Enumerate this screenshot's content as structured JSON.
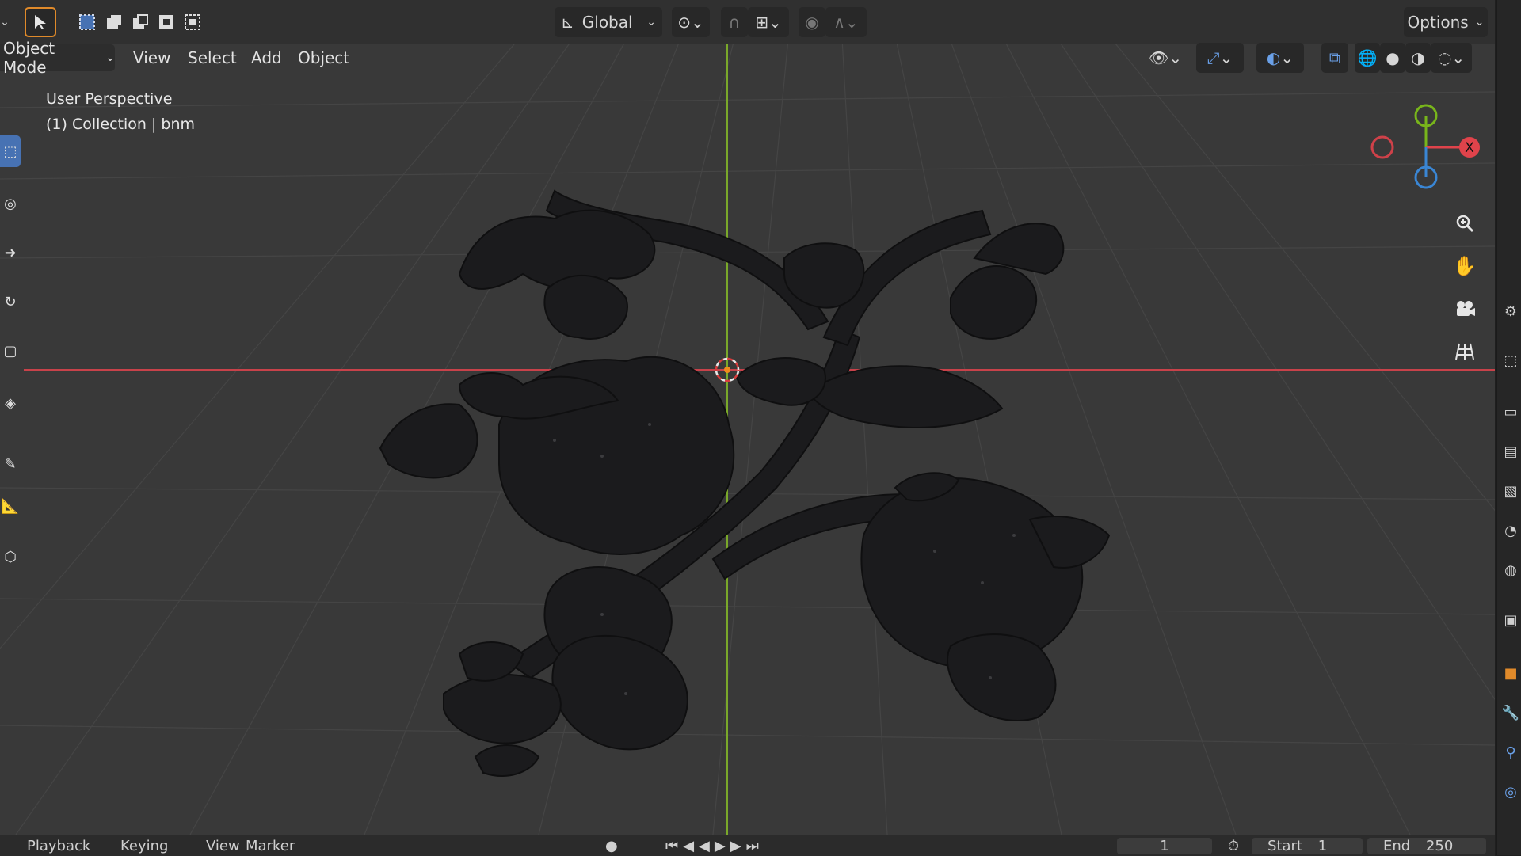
{
  "header": {
    "transform_orientation": "Global",
    "options_label": "Options",
    "icons": {
      "select_tool": "cursor-arrow-icon",
      "select_modes": [
        "select-new-icon",
        "select-extend-icon",
        "select-subtract-icon",
        "select-invert-icon",
        "select-intersect-icon"
      ],
      "orientation": "transform-orientation-icon",
      "pivot": "pivot-point-icon",
      "snap": "snap-magnet-icon",
      "snap_target": "snap-increment-icon",
      "proportional": "proportional-editing-icon",
      "falloff": "falloff-curve-icon"
    }
  },
  "view_header": {
    "mode": "Object Mode",
    "menus": [
      "View",
      "Select",
      "Add",
      "Object"
    ],
    "icons": [
      "visibility-eye-icon",
      "gizmo-icon",
      "overlay-icon",
      "xray-icon",
      "wireframe-shading-icon",
      "solid-shading-icon",
      "material-shading-icon",
      "rendered-shading-icon"
    ]
  },
  "viewport": {
    "perspective_label": "User Perspective",
    "collection_label": "(1) Collection | bnm",
    "axis_x_label": "X",
    "colors": {
      "x_axis": "#e0434b",
      "y_axis": "#78b51b",
      "z_axis": "#3a86d4",
      "background": "#393939",
      "model": "#1c1c1e"
    },
    "navigation": [
      "zoom-icon",
      "pan-hand-icon",
      "camera-icon",
      "grid-toggle-icon"
    ]
  },
  "left_toolbar": [
    "select-box-icon",
    "cursor-icon",
    "move-icon",
    "rotate-icon",
    "scale-icon",
    "transform-icon",
    "annotate-icon",
    "measure-icon",
    "add-cube-icon"
  ],
  "props_strip": [
    "tool-icon",
    "render-icon",
    "output-icon",
    "view-layer-icon",
    "scene-icon",
    "world-icon",
    "collection-icon",
    "object-icon",
    "modifier-icon",
    "particles-icon",
    "physics-icon",
    "constraints-icon"
  ],
  "timeline": {
    "items": [
      "Playback",
      "Keying",
      "View",
      "Marker"
    ],
    "start_label": "Start",
    "start_value": "1",
    "end_label": "End",
    "end_value": "250",
    "current_frame": "1"
  }
}
